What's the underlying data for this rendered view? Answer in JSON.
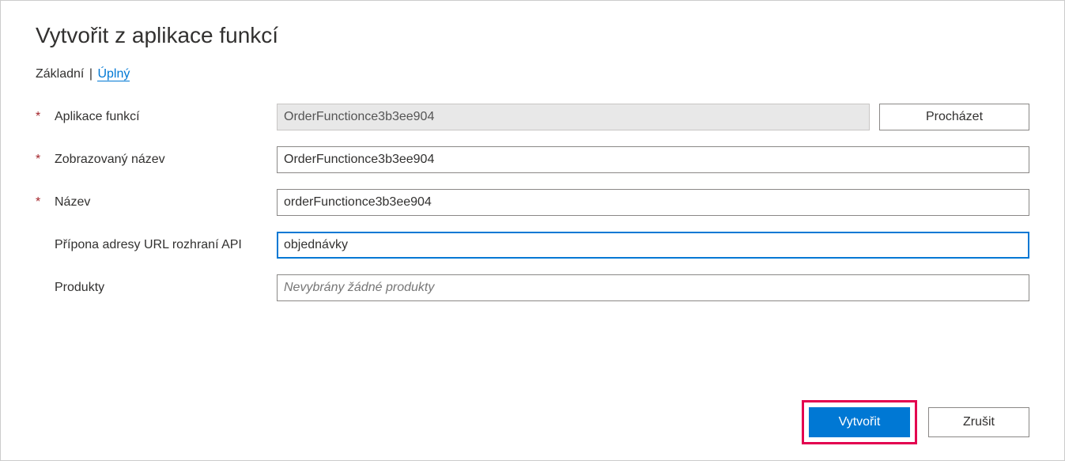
{
  "title": "Vytvořit z aplikace funkcí",
  "tabs": {
    "basic": "Základní",
    "separator": "|",
    "full": "Úplný"
  },
  "form": {
    "functionApp": {
      "label": "Aplikace funkcí",
      "value": "OrderFunctionce3b3ee904",
      "browse": "Procházet",
      "required": true
    },
    "displayName": {
      "label": "Zobrazovaný název",
      "value": "OrderFunctionce3b3ee904",
      "required": true
    },
    "name": {
      "label": "Název",
      "value": "orderFunctionce3b3ee904",
      "required": true
    },
    "apiUrlSuffix": {
      "label": "Přípona adresy URL rozhraní API",
      "value": "objednávky",
      "required": false
    },
    "products": {
      "label": "Produkty",
      "placeholder": "Nevybrány žádné produkty",
      "value": "",
      "required": false
    }
  },
  "footer": {
    "create": "Vytvořit",
    "cancel": "Zrušit"
  }
}
